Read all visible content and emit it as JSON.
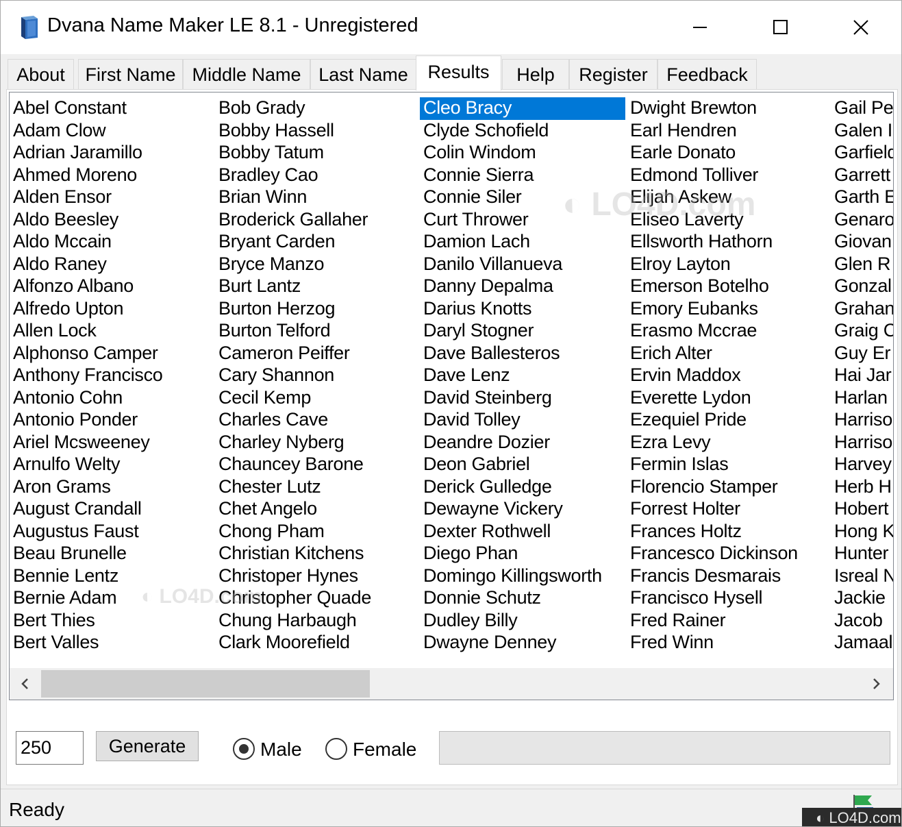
{
  "window": {
    "title": "Dvana Name Maker LE 8.1 - Unregistered",
    "icon": "book-icon"
  },
  "tabs": [
    {
      "label": "About"
    },
    {
      "label": "First Name"
    },
    {
      "label": "Middle Name"
    },
    {
      "label": "Last Name"
    },
    {
      "label": "Results",
      "active": true
    },
    {
      "label": "Help"
    },
    {
      "label": "Register"
    },
    {
      "label": "Feedback"
    }
  ],
  "results": {
    "selected": "Cleo Bracy",
    "columns": [
      [
        "Abel Constant",
        "Adam Clow",
        "Adrian Jaramillo",
        "Ahmed Moreno",
        "Alden Ensor",
        "Aldo Beesley",
        "Aldo Mccain",
        "Aldo Raney",
        "Alfonzo Albano",
        "Alfredo Upton",
        "Allen Lock",
        "Alphonso Camper",
        "Anthony Francisco",
        "Antonio Cohn",
        "Antonio Ponder",
        "Ariel Mcsweeney",
        "Arnulfo Welty",
        "Aron Grams",
        "August Crandall",
        "Augustus Faust",
        "Beau Brunelle",
        "Bennie Lentz",
        "Bernie Adam",
        "Bert Thies",
        "Bert Valles"
      ],
      [
        "Bob Grady",
        "Bobby Hassell",
        "Bobby Tatum",
        "Bradley Cao",
        "Brian Winn",
        "Broderick Gallaher",
        "Bryant Carden",
        "Bryce Manzo",
        "Burt Lantz",
        "Burton Herzog",
        "Burton Telford",
        "Cameron Peiffer",
        "Cary Shannon",
        "Cecil Kemp",
        "Charles Cave",
        "Charley Nyberg",
        "Chauncey Barone",
        "Chester Lutz",
        "Chet Angelo",
        "Chong Pham",
        "Christian Kitchens",
        "Christoper Hynes",
        "Christopher Quade",
        "Chung Harbaugh",
        "Clark Moorefield"
      ],
      [
        "Cleo Bracy",
        "Clyde Schofield",
        "Colin Windom",
        "Connie Sierra",
        "Connie Siler",
        "Curt Thrower",
        "Damion Lach",
        "Danilo Villanueva",
        "Danny Depalma",
        "Darius Knotts",
        "Daryl Stogner",
        "Dave Ballesteros",
        "Dave Lenz",
        "David Steinberg",
        "David Tolley",
        "Deandre Dozier",
        "Deon Gabriel",
        "Derick Gulledge",
        "Dewayne Vickery",
        "Dexter Rothwell",
        "Diego Phan",
        "Domingo Killingsworth",
        "Donnie Schutz",
        "Dudley Billy",
        "Dwayne Denney"
      ],
      [
        "Dwight Brewton",
        "Earl Hendren",
        "Earle Donato",
        "Edmond Tolliver",
        "Elijah Askew",
        "Eliseo Laverty",
        "Ellsworth Hathorn",
        "Elroy Layton",
        "Emerson Botelho",
        "Emory Eubanks",
        "Erasmo Mccrae",
        "Erich Alter",
        "Ervin Maddox",
        "Everette Lydon",
        "Ezequiel Pride",
        "Ezra Levy",
        "Fermin Islas",
        "Florencio Stamper",
        "Forrest Holter",
        "Frances Holtz",
        "Francesco Dickinson",
        "Francis Desmarais",
        "Francisco Hysell",
        "Fred Rainer",
        "Fred Winn"
      ],
      [
        "Gail Pe",
        "Galen I",
        "Garfield",
        "Garrett",
        "Garth E",
        "Genaro",
        "Giovan",
        "Glen R",
        "Gonzal",
        "Grahan",
        "Graig C",
        "Guy Er",
        "Hai Jar",
        "Harlan",
        "Harriso",
        "Harriso",
        "Harvey",
        "Herb H",
        "Hobert",
        "Hong K",
        "Hunter",
        "Isreal N",
        "Jackie",
        "Jacob",
        "Jamaal"
      ]
    ]
  },
  "controls": {
    "count_value": "250",
    "generate_label": "Generate",
    "gender_options": [
      {
        "label": "Male",
        "checked": true
      },
      {
        "label": "Female",
        "checked": false
      }
    ],
    "progress": 0
  },
  "status": {
    "text": "Ready",
    "icon": "flag-icon"
  },
  "watermark": {
    "text": "LO4D.com"
  }
}
